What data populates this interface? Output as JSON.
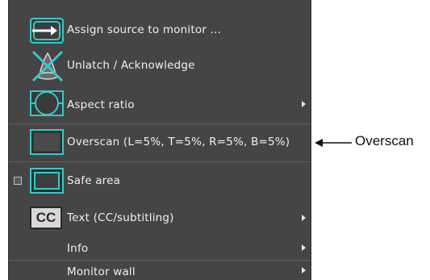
{
  "menu": {
    "items": [
      {
        "label": "Assign source to monitor ...",
        "icon": "assign-source-icon",
        "submenu": false
      },
      {
        "label": "Unlatch / Acknowledge",
        "icon": "unlatch-acknowledge-icon",
        "submenu": false
      },
      {
        "label": "Aspect ratio",
        "icon": "aspect-ratio-icon",
        "submenu": true
      },
      {
        "label": "Overscan (L=5%, T=5%, R=5%, B=5%)",
        "icon": "overscan-icon",
        "submenu": false,
        "highlighted": true
      },
      {
        "label": "Safe area",
        "icon": "safe-area-icon",
        "submenu": false,
        "checkbox": true,
        "checked": false
      },
      {
        "label": "Text (CC/subtitling)",
        "icon": "cc-text-icon",
        "submenu": true,
        "icon_text": "CC"
      },
      {
        "label": "Info",
        "submenu": true
      },
      {
        "label": "Monitor wall",
        "submenu": true
      }
    ]
  },
  "annotation": {
    "label": "Overscan"
  },
  "colors": {
    "menu_bg": "#454545",
    "icon_teal": "#38c8c8",
    "text": "#f0f0f0"
  }
}
